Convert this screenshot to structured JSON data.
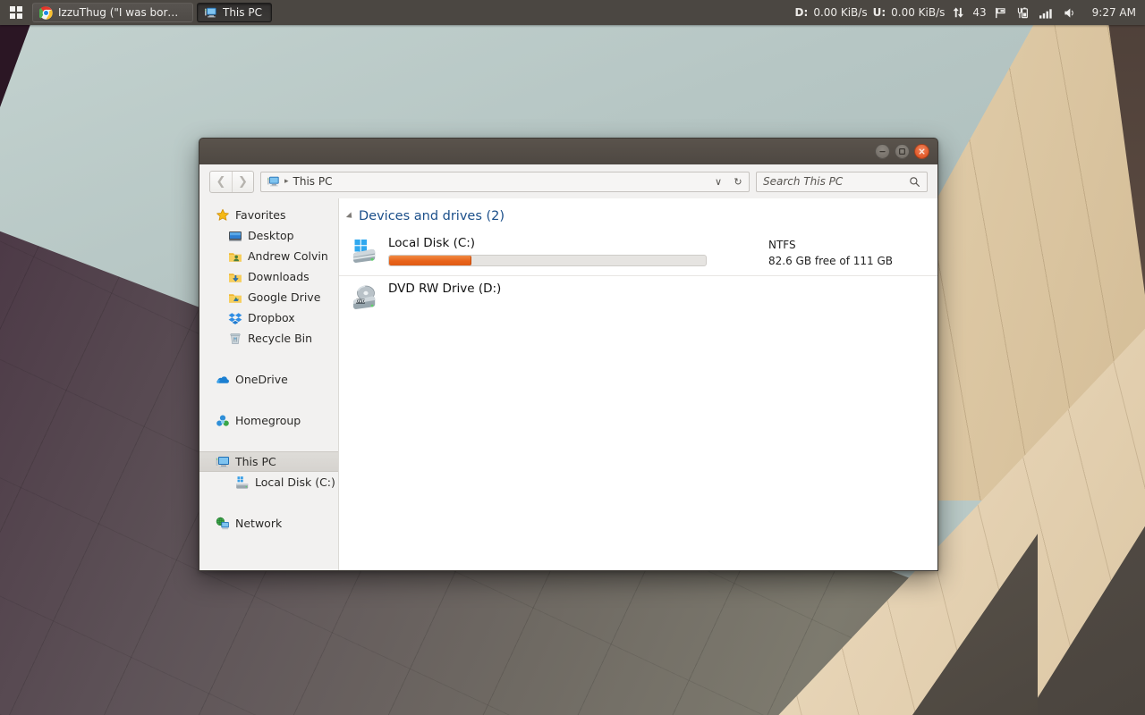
{
  "taskbar": {
    "start": {
      "icon": "windows-logo-icon",
      "label": "Start"
    },
    "buttons": [
      {
        "icon": "chrome-icon",
        "label": "IzzuThug (\"I was born...",
        "active": false
      },
      {
        "icon": "this-pc-icon",
        "label": "This PC",
        "active": true
      }
    ],
    "tray": {
      "download_label": "D:",
      "download_rate": "0.00 KiB/s",
      "upload_label": "U:",
      "upload_rate": "0.00 KiB/s",
      "net_arrows_icon": "network-arrows-icon",
      "workspace": "43",
      "flag_icon": "flag-icon",
      "battery_icon": "battery-icon",
      "signal_icon": "signal-bars-icon",
      "volume_icon": "volume-icon",
      "clock": "9:27 AM"
    }
  },
  "window": {
    "title": "",
    "controls": {
      "minimize": "minimize-button",
      "maximize": "maximize-button",
      "close": "close-button"
    },
    "nav": {
      "back": "Back",
      "forward": "Forward",
      "address_icon": "this-pc-icon",
      "breadcrumb": "This PC",
      "separator": "▸",
      "dropdown": "∨",
      "refresh": "↻"
    },
    "search": {
      "placeholder": "Search This PC",
      "value": "",
      "icon": "search-icon"
    }
  },
  "sidebar": {
    "items": [
      {
        "label": "Favorites",
        "icon": "star-icon",
        "level": 0,
        "selected": false,
        "gap_before": false
      },
      {
        "label": "Desktop",
        "icon": "desktop-icon",
        "level": 1,
        "selected": false,
        "gap_before": false
      },
      {
        "label": "Andrew Colvin",
        "icon": "user-folder-icon",
        "level": 1,
        "selected": false,
        "gap_before": false
      },
      {
        "label": "Downloads",
        "icon": "downloads-icon",
        "level": 1,
        "selected": false,
        "gap_before": false
      },
      {
        "label": "Google Drive",
        "icon": "gdrive-folder-icon",
        "level": 1,
        "selected": false,
        "gap_before": false
      },
      {
        "label": "Dropbox",
        "icon": "dropbox-icon",
        "level": 1,
        "selected": false,
        "gap_before": false
      },
      {
        "label": "Recycle Bin",
        "icon": "recycle-bin-icon",
        "level": 1,
        "selected": false,
        "gap_before": false
      },
      {
        "label": "OneDrive",
        "icon": "onedrive-icon",
        "level": 0,
        "selected": false,
        "gap_before": true
      },
      {
        "label": "Homegroup",
        "icon": "homegroup-icon",
        "level": 0,
        "selected": false,
        "gap_before": true
      },
      {
        "label": "This PC",
        "icon": "this-pc-icon",
        "level": 0,
        "selected": true,
        "gap_before": true
      },
      {
        "label": "Local Disk (C:)",
        "icon": "hdd-icon",
        "level": 1,
        "selected": false,
        "gap_before": false
      },
      {
        "label": "Network",
        "icon": "network-icon",
        "level": 0,
        "selected": false,
        "gap_before": true
      }
    ]
  },
  "content": {
    "section": {
      "title": "Devices and drives (2)",
      "count": 2,
      "collapse_icon": "collapse-triangle-icon"
    },
    "drives": [
      {
        "name": "Local Disk (C:)",
        "icon": "windows-drive-icon",
        "filesystem": "NTFS",
        "capacity_text": "82.6 GB free of 111 GB",
        "free_gb": 82.6,
        "total_gb": 111,
        "used_percent": 26,
        "has_bar": true,
        "bar_color": "#e8631a"
      },
      {
        "name": "DVD RW Drive (D:)",
        "icon": "dvd-drive-icon",
        "filesystem": "",
        "capacity_text": "",
        "has_bar": false
      }
    ]
  },
  "colors": {
    "accent_orange": "#e8631a",
    "taskbar": "#4b4742",
    "titlebar": "#554e48",
    "close_button": "#dd4814",
    "section_title": "#1b4f8a"
  }
}
